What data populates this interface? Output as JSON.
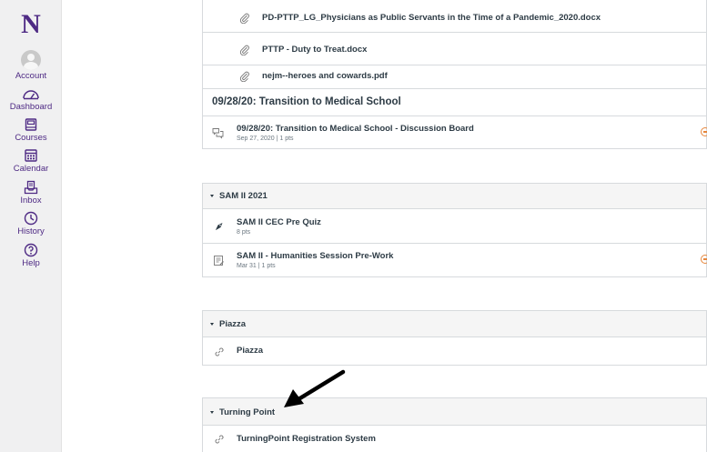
{
  "nav": {
    "logo": "N",
    "items": [
      {
        "label": "Account",
        "icon": "user-avatar-icon"
      },
      {
        "label": "Dashboard",
        "icon": "dashboard-gauge-icon"
      },
      {
        "label": "Courses",
        "icon": "book-icon"
      },
      {
        "label": "Calendar",
        "icon": "calendar-icon"
      },
      {
        "label": "Inbox",
        "icon": "inbox-tray-icon"
      },
      {
        "label": "History",
        "icon": "clock-icon"
      },
      {
        "label": "Help",
        "icon": "question-circle-icon"
      }
    ]
  },
  "files": [
    {
      "title": "PD-PTTP_LG_Physicians as Public Servants in the Time of a Pandemic_2020.docx",
      "icon": "paperclip-icon"
    },
    {
      "title": "PTTP - Duty to Treat.docx",
      "icon": "paperclip-icon"
    },
    {
      "title": "nejm--heroes and cowards.pdf",
      "icon": "paperclip-icon"
    }
  ],
  "transition": {
    "header": "09/28/20: Transition to Medical School",
    "discussion": {
      "title": "09/28/20: Transition to Medical School - Discussion Board",
      "meta": "Sep 27, 2020  |  1 pts",
      "icon": "discussion-icon"
    }
  },
  "modules": [
    {
      "name": "SAM II 2021",
      "items": [
        {
          "title": "SAM II CEC Pre Quiz",
          "meta": "8 pts",
          "icon": "quiz-rocket-icon"
        },
        {
          "title": "SAM II - Humanities Session Pre-Work",
          "meta": "Mar 31  |  1 pts",
          "icon": "assignment-icon"
        }
      ]
    },
    {
      "name": "Piazza",
      "items": [
        {
          "title": "Piazza",
          "icon": "link-icon"
        }
      ]
    },
    {
      "name": "Turning Point",
      "items": [
        {
          "title": "TurningPoint Registration System",
          "icon": "link-icon"
        }
      ]
    }
  ],
  "colors": {
    "brand": "#4e2a84",
    "status": "#e6863b",
    "text": "#2d3b45",
    "border": "#d7dadd",
    "header_bg": "#f5f5f5"
  }
}
